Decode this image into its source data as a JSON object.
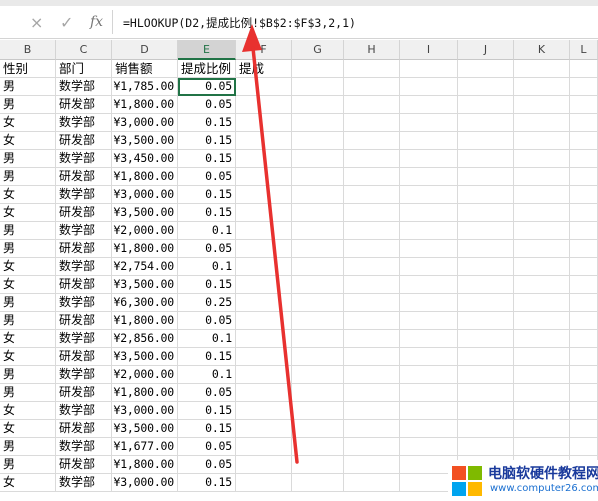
{
  "formula_bar": {
    "cancel_icon": "×",
    "enter_icon": "✓",
    "fx_label": "fx",
    "formula": "=HLOOKUP(D2,提成比例!$B$2:$F$3,2,1)"
  },
  "columns": [
    {
      "label": "B"
    },
    {
      "label": "C"
    },
    {
      "label": "D"
    },
    {
      "label": "E"
    },
    {
      "label": "F"
    },
    {
      "label": "G"
    },
    {
      "label": "H"
    },
    {
      "label": "I"
    },
    {
      "label": "J"
    },
    {
      "label": "K"
    },
    {
      "label": "L"
    }
  ],
  "header_row": {
    "gender": "性别",
    "department": "部门",
    "sales": "销售额",
    "rate": "提成比例",
    "commission": "提成"
  },
  "rows": [
    {
      "gender": "男",
      "department": "数学部",
      "sales": "¥1,785.00",
      "rate": "0.05"
    },
    {
      "gender": "男",
      "department": "研发部",
      "sales": "¥1,800.00",
      "rate": "0.05"
    },
    {
      "gender": "女",
      "department": "数学部",
      "sales": "¥3,000.00",
      "rate": "0.15"
    },
    {
      "gender": "女",
      "department": "研发部",
      "sales": "¥3,500.00",
      "rate": "0.15"
    },
    {
      "gender": "男",
      "department": "数学部",
      "sales": "¥3,450.00",
      "rate": "0.15"
    },
    {
      "gender": "男",
      "department": "研发部",
      "sales": "¥1,800.00",
      "rate": "0.05"
    },
    {
      "gender": "女",
      "department": "数学部",
      "sales": "¥3,000.00",
      "rate": "0.15"
    },
    {
      "gender": "女",
      "department": "研发部",
      "sales": "¥3,500.00",
      "rate": "0.15"
    },
    {
      "gender": "男",
      "department": "数学部",
      "sales": "¥2,000.00",
      "rate": "0.1"
    },
    {
      "gender": "男",
      "department": "研发部",
      "sales": "¥1,800.00",
      "rate": "0.05"
    },
    {
      "gender": "女",
      "department": "数学部",
      "sales": "¥2,754.00",
      "rate": "0.1"
    },
    {
      "gender": "女",
      "department": "研发部",
      "sales": "¥3,500.00",
      "rate": "0.15"
    },
    {
      "gender": "男",
      "department": "数学部",
      "sales": "¥6,300.00",
      "rate": "0.25"
    },
    {
      "gender": "男",
      "department": "研发部",
      "sales": "¥1,800.00",
      "rate": "0.05"
    },
    {
      "gender": "女",
      "department": "数学部",
      "sales": "¥2,856.00",
      "rate": "0.1"
    },
    {
      "gender": "女",
      "department": "研发部",
      "sales": "¥3,500.00",
      "rate": "0.15"
    },
    {
      "gender": "男",
      "department": "数学部",
      "sales": "¥2,000.00",
      "rate": "0.1"
    },
    {
      "gender": "男",
      "department": "研发部",
      "sales": "¥1,800.00",
      "rate": "0.05"
    },
    {
      "gender": "女",
      "department": "数学部",
      "sales": "¥3,000.00",
      "rate": "0.15"
    },
    {
      "gender": "女",
      "department": "研发部",
      "sales": "¥3,500.00",
      "rate": "0.15"
    },
    {
      "gender": "男",
      "department": "数学部",
      "sales": "¥1,677.00",
      "rate": "0.05"
    },
    {
      "gender": "男",
      "department": "研发部",
      "sales": "¥1,800.00",
      "rate": "0.05"
    },
    {
      "gender": "女",
      "department": "数学部",
      "sales": "¥3,000.00",
      "rate": "0.15"
    }
  ],
  "annotation": {
    "arrow_color": "#e8312f"
  },
  "watermark": {
    "title": "电脑软硬件教程网",
    "url": "www.computer26.com"
  }
}
